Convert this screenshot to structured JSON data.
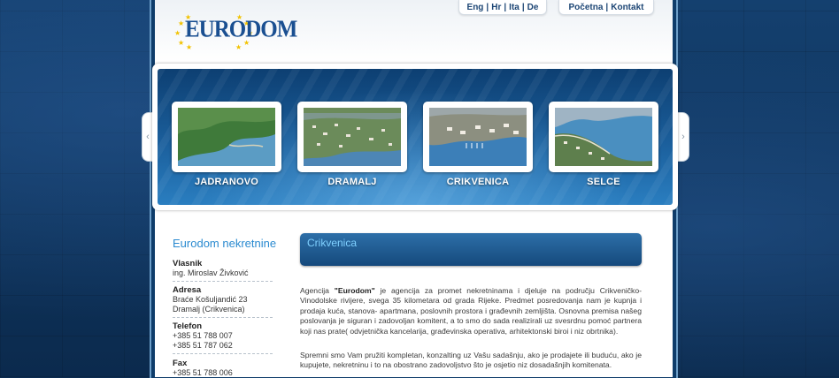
{
  "logo": {
    "text": "EURODOM"
  },
  "lang_tab": {
    "items": [
      "Eng",
      "Hr",
      "Ita",
      "De"
    ]
  },
  "nav_tab": {
    "items": [
      "Početna",
      "Kontakt"
    ]
  },
  "banner": {
    "items": [
      {
        "label": "JADRANOVO"
      },
      {
        "label": "DRAMALJ"
      },
      {
        "label": "CRIKVENICA"
      },
      {
        "label": "SELCE"
      }
    ],
    "prev_icon": "chevron-left-icon",
    "next_icon": "chevron-right-icon"
  },
  "sidebar": {
    "title": "Eurodom nekretnine",
    "blocks": [
      {
        "label": "Vlasnik",
        "lines": [
          "ing. Miroslav Živković"
        ]
      },
      {
        "label": "Adresa",
        "lines": [
          "Braće Košuljandić 23",
          "Dramalj (Crikvenica)"
        ]
      },
      {
        "label": "Telefon",
        "lines": [
          "+385 51 788 007",
          "+385 51 787 062"
        ]
      },
      {
        "label": "Fax",
        "lines": [
          "+385 51 788 006"
        ]
      }
    ]
  },
  "content": {
    "heading": "Crikvenica",
    "p1_before": "Agencija ",
    "p1_bold": "\"Eurodom\"",
    "p1_after": " je agencija za promet nekretninama i djeluje na području Crikveničko-Vinodolske rivijere, svega 35 kilometara od grada Rijeke. Predmet posredovanja nam je kupnja i prodaja kuća, stanova- apartmana, poslovnih prostora i građevnih zemljišta. Osnovna premisa našeg poslovanja je siguran i zadovoljan komitent, a to smo do sada realizirali uz svesrdnu pomoć partnera koji nas prate( odvjetnička kancelarija, građevinska operativa, arhitektonski biroi i niz obrtnika).",
    "p2": "Spremni smo Vam pružiti kompletan, konzalting uz Vašu sadašnju, ako je prodajete ili buduću, ako je kupujete, nekretninu i to na obostrano zadovoljstvo što je osjetio niz dosadašnjih komitenata."
  }
}
